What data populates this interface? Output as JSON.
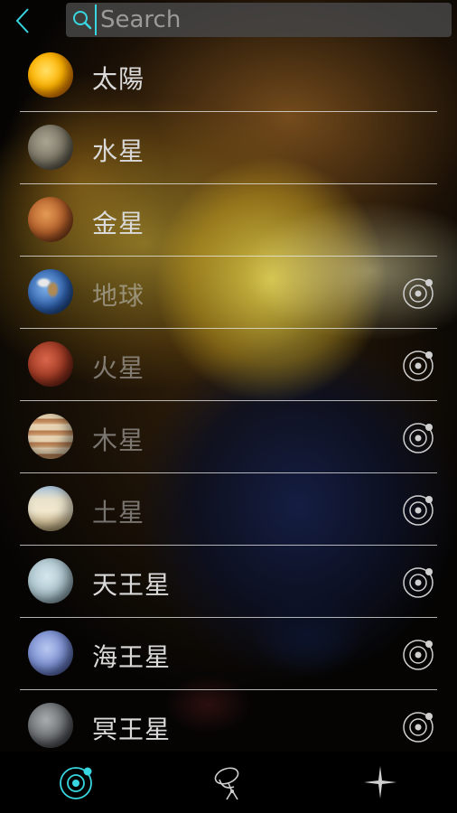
{
  "header": {
    "back_icon": "chevron-left-icon",
    "search": {
      "placeholder": "Search",
      "value": "",
      "icon": "search-icon"
    }
  },
  "colors": {
    "accent": "#38d6e0",
    "divider": "#e6e6e6",
    "text": "#d9d9d9"
  },
  "planets": [
    {
      "label": "太陽",
      "icon": "sun-icon",
      "has_orbit_button": false
    },
    {
      "label": "水星",
      "icon": "mercury-icon",
      "has_orbit_button": false
    },
    {
      "label": "金星",
      "icon": "venus-icon",
      "has_orbit_button": false
    },
    {
      "label": "地球",
      "icon": "earth-icon",
      "has_orbit_button": true
    },
    {
      "label": "火星",
      "icon": "mars-icon",
      "has_orbit_button": true
    },
    {
      "label": "木星",
      "icon": "jupiter-icon",
      "has_orbit_button": true
    },
    {
      "label": "土星",
      "icon": "saturn-icon",
      "has_orbit_button": true
    },
    {
      "label": "天王星",
      "icon": "uranus-icon",
      "has_orbit_button": true
    },
    {
      "label": "海王星",
      "icon": "neptune-icon",
      "has_orbit_button": true
    },
    {
      "label": "冥王星",
      "icon": "pluto-icon",
      "has_orbit_button": true
    }
  ],
  "tabbar": {
    "tabs": [
      {
        "icon": "solar-system-icon",
        "active": true
      },
      {
        "icon": "satellite-icon",
        "active": false
      },
      {
        "icon": "star-icon",
        "active": false
      }
    ]
  }
}
